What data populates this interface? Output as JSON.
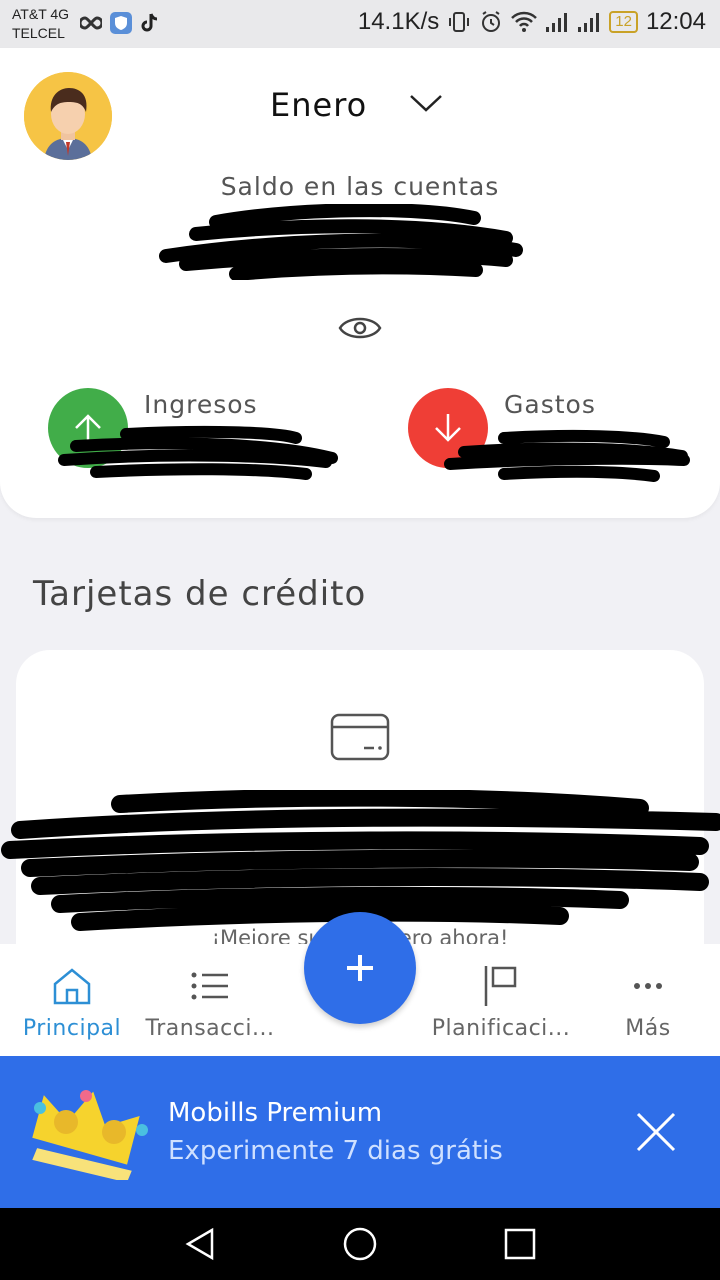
{
  "status_bar": {
    "carrier_line1": "AT&T 4G",
    "carrier_line2": "TELCEL",
    "net_speed": "14.1K/s",
    "battery": "12",
    "time": "12:04"
  },
  "header": {
    "month": "Enero",
    "balance_label": "Saldo en las cuentas",
    "income_label": "Ingresos",
    "expense_label": "Gastos"
  },
  "credit_cards": {
    "section_title": "Tarjetas de crédito",
    "partial_text": "¡Mejore su cor          nciero ahora!"
  },
  "bottom_nav": {
    "items": [
      {
        "label": "Principal",
        "icon": "home-icon"
      },
      {
        "label": "Transacci...",
        "icon": "list-icon"
      },
      {
        "label": "Planificaci...",
        "icon": "flag-icon"
      },
      {
        "label": "Más",
        "icon": "more-icon"
      }
    ],
    "fab_icon": "plus-icon"
  },
  "premium_banner": {
    "title": "Mobills Premium",
    "subtitle": "Experimente 7 dias grátis"
  },
  "colors": {
    "accent_blue": "#2f6ee8",
    "active_tab": "#2d8fd5",
    "income_green": "#41ad49",
    "expense_red": "#ef3e36"
  }
}
